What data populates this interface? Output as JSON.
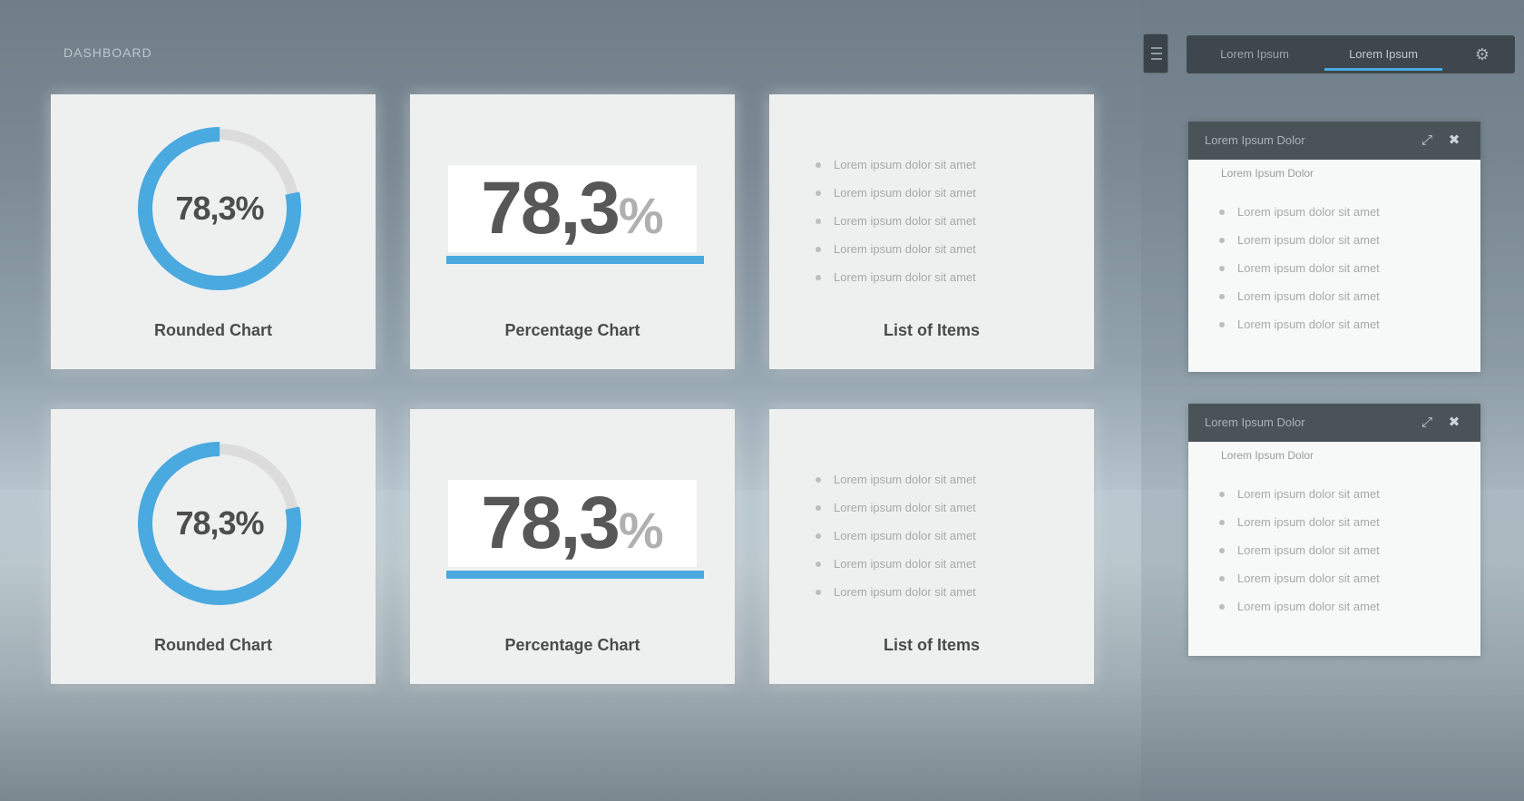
{
  "app": {
    "title": "DASHBOARD"
  },
  "topbar": {
    "tabs": [
      "Lorem Ipsum",
      "Lorem Ipsum"
    ],
    "settings_icon": "gear-icon",
    "menu_icon": "hamburger-icon"
  },
  "colors": {
    "accent": "#4aa9df",
    "donut_track": "#dcdcdc",
    "card_bg": "#eef0f0"
  },
  "cards": [
    {
      "type": "rounded",
      "value_text": "78,3%",
      "value": 78.3,
      "label": "Rounded Chart"
    },
    {
      "type": "percentage",
      "value_text": "78,3",
      "percent_sign": "%",
      "value": 78.3,
      "label": "Percentage Chart"
    },
    {
      "type": "list",
      "items": [
        "Lorem ipsum dolor sit amet",
        "Lorem ipsum dolor sit amet",
        "Lorem ipsum dolor sit amet",
        "Lorem ipsum dolor sit amet",
        "Lorem ipsum dolor sit amet"
      ],
      "label": "List of Items"
    },
    {
      "type": "rounded",
      "value_text": "78,3%",
      "value": 78.3,
      "label": "Rounded Chart"
    },
    {
      "type": "percentage",
      "value_text": "78,3",
      "percent_sign": "%",
      "value": 78.3,
      "label": "Percentage Chart"
    },
    {
      "type": "list",
      "items": [
        "Lorem ipsum dolor sit amet",
        "Lorem ipsum dolor sit amet",
        "Lorem ipsum dolor sit amet",
        "Lorem ipsum dolor sit amet",
        "Lorem ipsum dolor sit amet"
      ],
      "label": "List of Items"
    }
  ],
  "widgets": [
    {
      "title": "Lorem Ipsum Dolor",
      "subtitle": "Lorem Ipsum Dolor",
      "items": [
        "Lorem ipsum dolor sit amet",
        "Lorem ipsum dolor sit amet",
        "Lorem ipsum dolor sit amet",
        "Lorem ipsum dolor sit amet",
        "Lorem ipsum dolor sit amet"
      ],
      "icons": [
        "expand-icon",
        "close-icon"
      ]
    },
    {
      "title": "Lorem Ipsum Dolor",
      "subtitle": "Lorem Ipsum Dolor",
      "items": [
        "Lorem ipsum dolor sit amet",
        "Lorem ipsum dolor sit amet",
        "Lorem ipsum dolor sit amet",
        "Lorem ipsum dolor sit amet",
        "Lorem ipsum dolor sit amet"
      ],
      "icons": [
        "expand-icon",
        "close-icon"
      ]
    }
  ]
}
